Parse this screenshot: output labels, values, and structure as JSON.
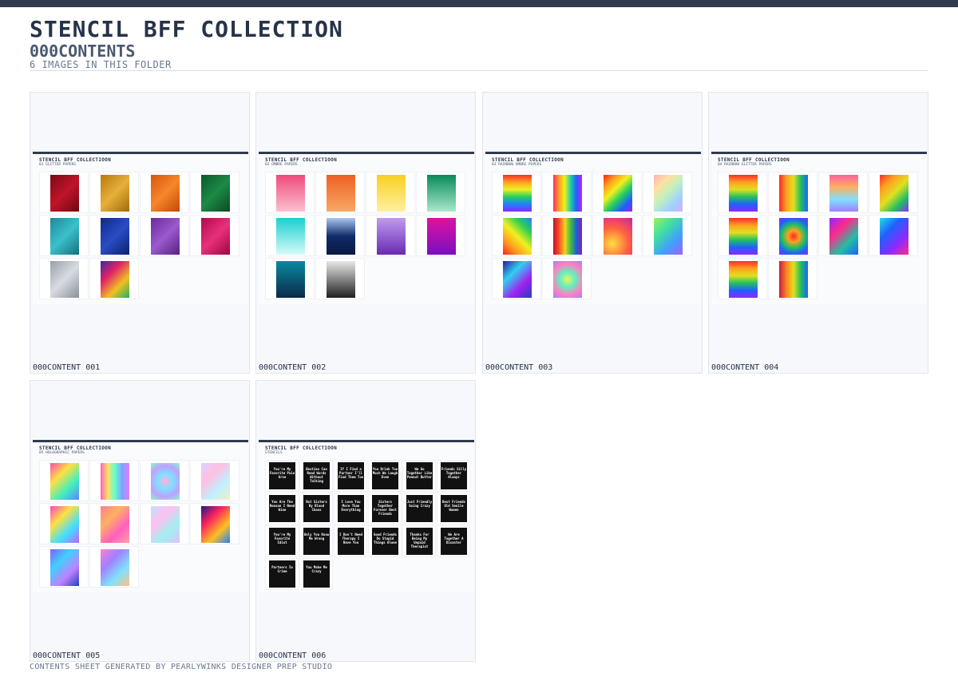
{
  "header": {
    "title": "STENCIL BFF COLLECTION",
    "subtitle": "000CONTENTS",
    "count": "6 IMAGES IN THIS FOLDER"
  },
  "footer": "CONTENTS SHEET GENERATED BY PEARLYWINKS DESIGNER PREP STUDIO",
  "cards": [
    {
      "label": "000CONTENT 001",
      "sheet_title": "STENCIL BFF COLLECTIOON",
      "sheet_sub": "01 GLITTER PAPERS",
      "swatches": [
        "linear-gradient(135deg,#7a0a12,#c0142a,#6d0810)",
        "linear-gradient(135deg,#b87a0c,#e6b03a,#a06a08)",
        "linear-gradient(135deg,#d8560c,#f7862a,#c24806)",
        "linear-gradient(135deg,#0a5a2a,#1c8a46,#084a22)",
        "linear-gradient(135deg,#1a8a9a,#3cc0cc,#14707e)",
        "linear-gradient(135deg,#102a8a,#2a4cc4,#0c2070)",
        "linear-gradient(135deg,#6a2a9a,#9a5ad0,#5a2080)",
        "linear-gradient(135deg,#b00a4a,#e8307a,#9a0840)",
        "linear-gradient(135deg,#9aa0a8,#d8dce2,#8a9098)",
        "linear-gradient(135deg,#3a2a9a,#e0206a,#f0c020,#20b060)"
      ]
    },
    {
      "label": "000CONTENT 002",
      "sheet_title": "STENCIL BFF COLLECTIOON",
      "sheet_sub": "02 OMBRE PAPERS",
      "swatches": [
        "linear-gradient(180deg,#f04a7a,#fbc0d0)",
        "linear-gradient(180deg,#ee6020,#f8a868)",
        "linear-gradient(180deg,#f8d020,#fff0a0)",
        "linear-gradient(180deg,#0a8a5a,#a8e8cc)",
        "linear-gradient(180deg,#1ad0d0,#d8fafa)",
        "linear-gradient(180deg,#a8c8f0,#102a6a,#0a1a40)",
        "linear-gradient(180deg,#c09af0,#6a2ab0)",
        "linear-gradient(180deg,#e010a0,#7a10c0)",
        "linear-gradient(180deg,#0a8aa0,#0a2a4a)",
        "linear-gradient(180deg,#e8e8e8,#202020)"
      ]
    },
    {
      "label": "000CONTENT 003",
      "sheet_title": "STENCIL BFF COLLECTIOON",
      "sheet_sub": "03 RAINBOW OMBRE PAPERS",
      "swatches": [
        "linear-gradient(180deg,#ff2a2a,#ffa020,#f0f020,#20d060,#2080ff,#8a2aff)",
        "linear-gradient(90deg,#ff2a6a,#ffa020,#f0f020,#20d0a0,#2060ff,#c020ff)",
        "linear-gradient(135deg,#ff1a1a,#ff9a1a,#f0f020,#20d060,#2060ff,#a020ff)",
        "linear-gradient(135deg,#ffb0c0,#ffe0a0,#c0f0c0,#a0d0ff,#d0b0ff)",
        "linear-gradient(45deg,#ff2020,#ff9a20,#f0f020,#30d050,#2080ff)",
        "linear-gradient(90deg,#c01030,#ff4a20,#ffd020,#40c040,#2060d0,#8020c0)",
        "radial-gradient(circle at 30% 70%,#ffe040,#ff6040,#d020a0)",
        "linear-gradient(135deg,#a0f060,#40e0a0,#40a0ff,#a060ff)",
        "linear-gradient(135deg,#2a1aa0,#30d0f0,#a020f0,#2040c0)",
        "radial-gradient(circle,#f0f060,#60f0c0,#ff80c0,#a080ff)"
      ]
    },
    {
      "label": "000CONTENT 004",
      "sheet_title": "STENCIL BFF COLLECTIOON",
      "sheet_sub": "04 RAINBOW GLITTER PAPERS",
      "swatches": [
        "linear-gradient(180deg,#ff2a2a,#ffa020,#e0e020,#20c060,#2060ff,#8a2aff)",
        "linear-gradient(90deg,#ff2a2a,#ffa020,#e0e020,#20c060,#2060ff)",
        "linear-gradient(180deg,#ff60a0,#ffb060,#80e0ff,#a080ff)",
        "linear-gradient(135deg,#ff2a2a,#ffa020,#e0e020,#20c060,#8a2aff)",
        "linear-gradient(180deg,#ff2a2a,#ffa020,#e0e020,#20c060,#2060ff,#8a2aff)",
        "radial-gradient(circle,#ff2a2a,#ffa020,#20c060,#2060ff,#8a2aff)",
        "linear-gradient(135deg,#8a2aff,#ff2a8a,#20c0a0,#2060ff)",
        "linear-gradient(135deg,#20e0e0,#2060ff,#8a2aff,#ff2a8a)",
        "linear-gradient(180deg,#ff2a2a,#ffa020,#e0e020,#20c060,#2060ff,#8a2aff)",
        "linear-gradient(90deg,#c02040,#ff8020,#e0e020,#20c060,#2060ff)"
      ]
    },
    {
      "label": "000CONTENT 005",
      "sheet_title": "STENCIL BFF COLLECTIOON",
      "sheet_sub": "05 HOLOGRAPHIC PAPERS",
      "swatches": [
        "linear-gradient(135deg,#ff4ab0,#ffe040,#40f0c0,#6080ff)",
        "linear-gradient(90deg,#ff60c0,#ffe060,#60ffd0,#80a0ff,#e080ff)",
        "radial-gradient(circle,#ffb0e0,#80e0ff,#c0a0ff,#80ffc0)",
        "linear-gradient(135deg,#e0d0ff,#ffc0e0,#c0f0ff,#f0f0c0)",
        "linear-gradient(135deg,#ff40c0,#ffe040,#40e0ff,#c060ff)",
        "linear-gradient(135deg,#ff8090,#ffb060,#ff60c0,#ffa0a0)",
        "linear-gradient(135deg,#c0e0ff,#ffc0f0,#a0f0f0,#e0c0ff)",
        "linear-gradient(135deg,#1a1a80,#ff2060,#ffc020,#2080ff)",
        "linear-gradient(135deg,#8060ff,#40d0ff,#c080ff,#2040c0)",
        "linear-gradient(135deg,#ff80d0,#a080ff,#80e0ff,#ffc080)"
      ]
    },
    {
      "label": "000CONTENT 006",
      "sheet_title": "STENCIL BFF COLLECTIOON",
      "sheet_sub": "STENCILS",
      "stencils": [
        "You're My Favorite Pain Arse",
        "Besties Can Read Words Without Talking",
        "If I Find a Partner I'll Find Them Too",
        "You Drink Too Much We Laugh Even",
        "We Go Together Like Peanut Butter",
        "Friends Silly Together Always",
        "You Are The Reason I Need Wine",
        "Not Sisters By Blood Chaos",
        "I Love You More Than Everything",
        "Sisters Together Forever Best Friends",
        "Just Friendly Going Crazy",
        "Best Friends Old Senile Women",
        "You're My Favorite Idiot",
        "Only You Know Me Wrong",
        "I Don't Need Therapy I Have You",
        "Good Friends Do Stupid Things Alone",
        "Thanks For Being My Unpaid Therapist",
        "We Are Together A Disaster",
        "Partners In Crime",
        "You Make Me Crazy"
      ]
    }
  ]
}
